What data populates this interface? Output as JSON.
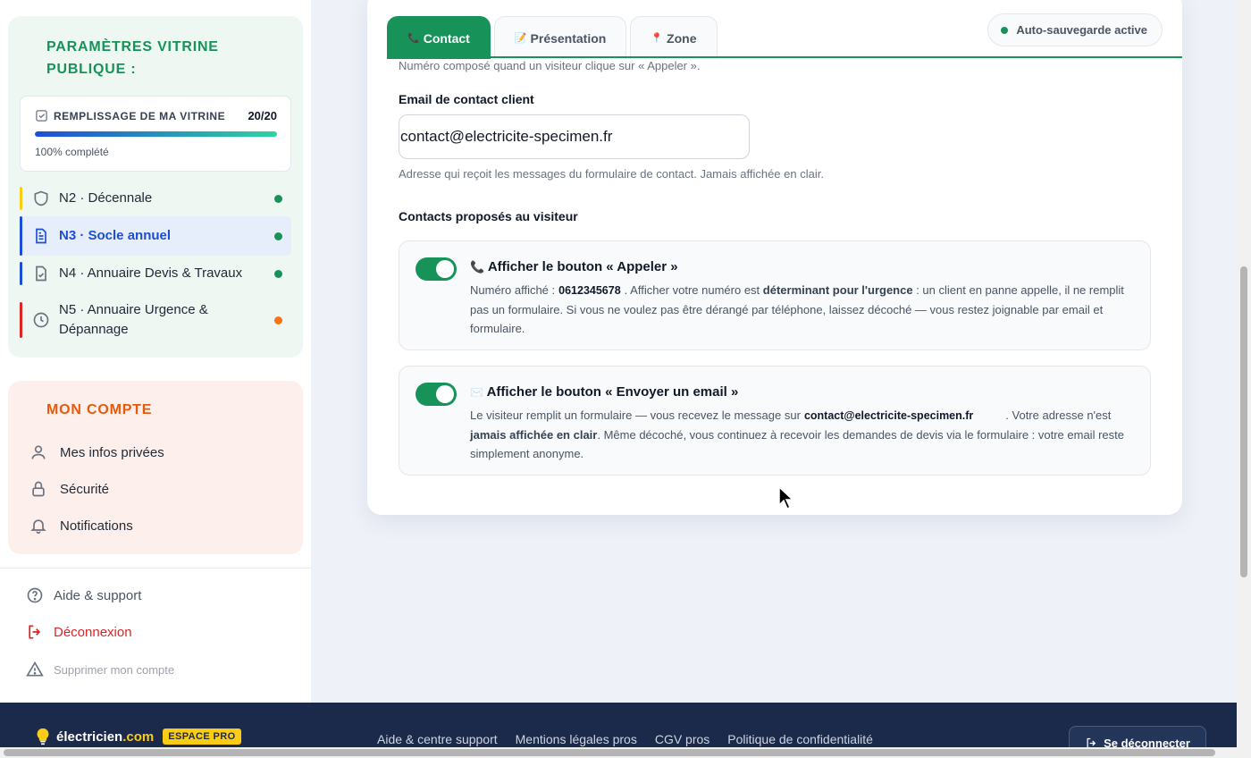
{
  "sidebar": {
    "vitrine_title": "PARAMÈTRES VITRINE PUBLIQUE :",
    "progress": {
      "label": "REMPLISSAGE DE MA VITRINE",
      "count": "20/20",
      "percent_text": "100% complété",
      "fraction": 1.0
    },
    "levels": [
      {
        "label": "N2 · Décennale",
        "stripe_color": "#facc15",
        "dot_color": "#17935a",
        "icon": "shield-icon"
      },
      {
        "label": "N3 · Socle annuel",
        "stripe_color": "#1d4ed8",
        "dot_color": "#17935a",
        "icon": "document-icon",
        "active": true
      },
      {
        "label": "N4 · Annuaire Devis & Travaux",
        "stripe_color": "#1d4ed8",
        "dot_color": "#17935a",
        "icon": "checklist-icon"
      },
      {
        "label": "N5 · Annuaire Urgence & Dépannage",
        "stripe_color": "#dc2626",
        "dot_color": "#f97316",
        "icon": "clock-icon"
      }
    ],
    "account_title": "MON COMPTE",
    "account_items": [
      {
        "label": "Mes infos privées",
        "icon": "user-icon"
      },
      {
        "label": "Sécurité",
        "icon": "lock-icon"
      },
      {
        "label": "Notifications",
        "icon": "bell-icon"
      }
    ],
    "help_label": "Aide & support",
    "logout_label": "Déconnexion",
    "delete_label": "Supprimer mon compte"
  },
  "main": {
    "tabs": [
      {
        "icon": "📞",
        "label": "Contact",
        "active": true
      },
      {
        "icon": "📝",
        "label": "Présentation"
      },
      {
        "icon": "📍",
        "label": "Zone"
      }
    ],
    "autosave_label": "Auto-sauvegarde active",
    "phone_hint": "Numéro composé quand un visiteur clique sur « Appeler ».",
    "email_label": "Email de contact client",
    "email_value": "contact@electricite-specimen.fr",
    "email_hint": "Adresse qui reçoit les messages du formulaire de contact. Jamais affichée en clair.",
    "section_title": "Contacts proposés au visiteur",
    "call_option": {
      "icon": "📞",
      "title": "Afficher le bouton « Appeler »",
      "enabled": true,
      "text_1": "Numéro affiché :",
      "phone": "0612345678",
      "text_2": ". Afficher votre numéro est",
      "bold": "déterminant pour l'urgence",
      "text_3": ": un client en panne appelle, il ne remplit pas un formulaire. Si vous ne voulez pas être dérangé par téléphone, laissez décoché — vous restez joignable par email et formulaire."
    },
    "email_option": {
      "icon": "✉️",
      "title": "Afficher le bouton « Envoyer un email »",
      "enabled": true,
      "text_1": "Le visiteur remplit un formulaire — vous recevez le message sur",
      "email": "contact@electricite-specimen.fr",
      "text_2": ". Votre adresse n'est",
      "bold": "jamais affichée en clair",
      "text_3": ". Même décoché, vous continuez à recevoir les demandes de devis via le formulaire : votre email reste simplement anonyme."
    }
  },
  "footer": {
    "brand_name": "électricien",
    "brand_tld": ".com",
    "brand_badge": "ESPACE PRO",
    "links": [
      "Aide & centre support",
      "Mentions légales pros",
      "CGV pros",
      "Politique de confidentialité"
    ],
    "logout_button": "Se déconnecter"
  }
}
